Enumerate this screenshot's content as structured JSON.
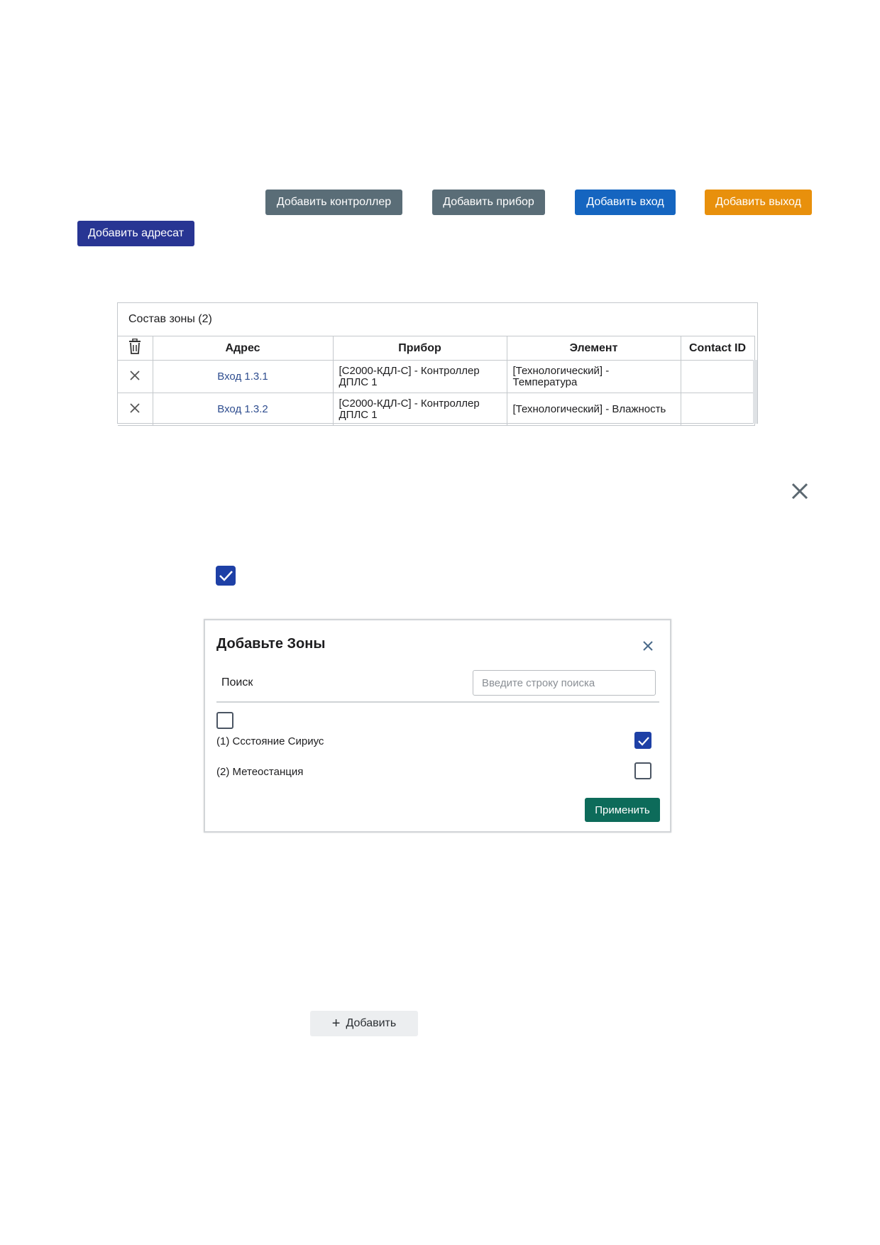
{
  "toolbar": {
    "add_controller": "Добавить контроллер",
    "add_device": "Добавить прибор",
    "add_input": "Добавить вход",
    "add_output": "Добавить выход",
    "add_addressee": "Добавить адресат"
  },
  "colors": {
    "gray_button": "#5a6d77",
    "blue_button": "#1565c0",
    "orange_button": "#e8900c",
    "indigo_button": "#283593",
    "apply_button": "#0d6b5a",
    "checkbox_checked": "#1e40a6"
  },
  "zone_panel": {
    "title": "Состав зоны (2)",
    "columns": [
      "Адрес",
      "Прибор",
      "Элемент",
      "Contact ID"
    ],
    "rows": [
      {
        "address": "Вход 1.3.1",
        "device": "[С2000-КДЛ-С] - Контроллер ДПЛС 1",
        "element": "[Технологический] - Температура",
        "contact_id": ""
      },
      {
        "address": "Вход 1.3.2",
        "device": "[С2000-КДЛ-С] - Контроллер ДПЛС 1",
        "element": "[Технологический] - Влажность",
        "contact_id": ""
      }
    ]
  },
  "standalone_checkbox": {
    "checked": true
  },
  "modal": {
    "title": "Добавьте Зоны",
    "search_label": "Поиск",
    "search_placeholder": "Введите строку поиска",
    "select_all_checked": false,
    "zones": [
      {
        "label": "(1) Сcстояние Сириус",
        "checked": true
      },
      {
        "label": "(2) Метеостанция",
        "checked": false
      }
    ],
    "apply": "Применить"
  },
  "add_button": {
    "icon": "plus-icon",
    "label": "Добавить"
  }
}
